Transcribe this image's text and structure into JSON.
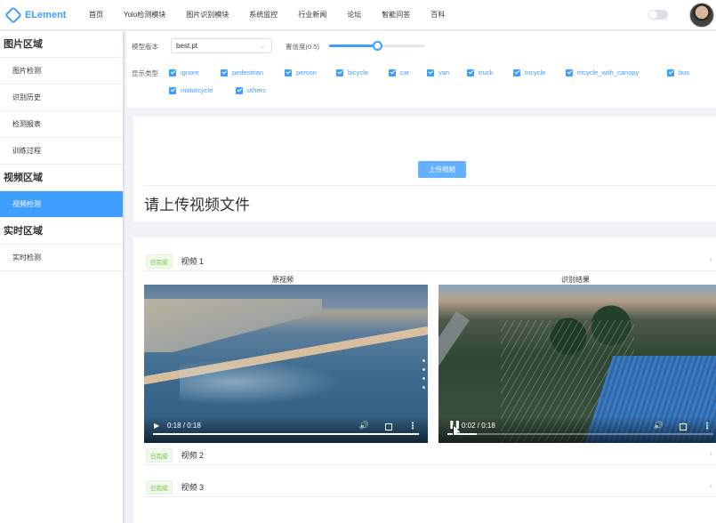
{
  "app": {
    "logo": "ELement"
  },
  "nav": [
    "首页",
    "Yolo检测模块",
    "图片识别模块",
    "系统监控",
    "行业新闻",
    "论坛",
    "智能问答",
    "百科"
  ],
  "sidebar": {
    "groups": [
      {
        "title": "图片区域",
        "items": [
          "图片检测",
          "识别历史",
          "检测报表",
          "训练过程"
        ]
      },
      {
        "title": "视频区域",
        "items": [
          "视频检测"
        ]
      },
      {
        "title": "实时区域",
        "items": [
          "实时检测"
        ]
      }
    ],
    "active_item": "视频检测"
  },
  "controls": {
    "model_label": "模型版本",
    "model_value": "best.pt",
    "confidence_label": "置信度(0.5)",
    "confidence_value": 0.5,
    "display_label": "显示类型",
    "classes": [
      "ignore",
      "pedestrian",
      "person",
      "bicycle",
      "car",
      "van",
      "truck",
      "tricycle",
      "tricycle_with_canopy",
      "bus",
      "motorcycle",
      "others"
    ]
  },
  "upload": {
    "button_label": "上传视频",
    "hint": "请上传视频文件"
  },
  "videos": [
    {
      "status": "已完成",
      "title": "视频 1",
      "original_label": "原视频",
      "result_label": "识别结果",
      "original_time": "0:18 / 0:18",
      "original_progress": 1.0,
      "result_time": "0:02 / 0:18",
      "result_progress": 0.11
    },
    {
      "status": "已完成",
      "title": "视频 2"
    },
    {
      "status": "已完成",
      "title": "视频 3"
    }
  ],
  "colors": {
    "accent": "#409eff",
    "success": "#67c23a"
  }
}
